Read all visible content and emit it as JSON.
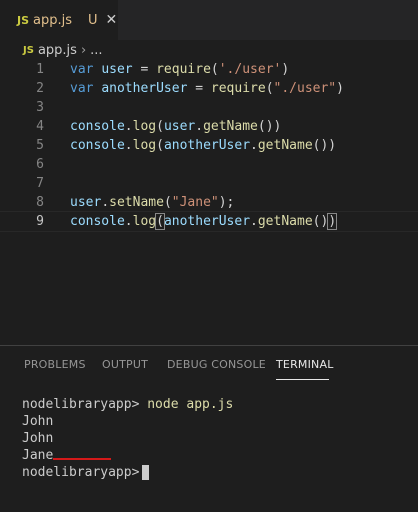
{
  "tab": {
    "icon": "JS",
    "filename": "app.js",
    "status": "U",
    "close": "✕"
  },
  "breadcrumb": {
    "icon": "JS",
    "file": "app.js",
    "separator": "›",
    "more": "..."
  },
  "editor": {
    "lines": [
      {
        "number": "1",
        "text": "var user = require('./user')"
      },
      {
        "number": "2",
        "text": "var anotherUser = require(\"./user\")"
      },
      {
        "number": "3",
        "text": ""
      },
      {
        "number": "4",
        "text": "console.log(user.getName())"
      },
      {
        "number": "5",
        "text": "console.log(anotherUser.getName())"
      },
      {
        "number": "6",
        "text": ""
      },
      {
        "number": "7",
        "text": ""
      },
      {
        "number": "8",
        "text": "user.setName(\"Jane\");"
      },
      {
        "number": "9",
        "text": "console.log(anotherUser.getName())"
      }
    ]
  },
  "panel": {
    "tabs": [
      "PROBLEMS",
      "OUTPUT",
      "DEBUG CONSOLE",
      "TERMINAL"
    ],
    "active_tab": "TERMINAL"
  },
  "terminal": {
    "prompt": "nodelibraryapp>",
    "command": "node app.js",
    "output": [
      "John",
      "John",
      "Jane"
    ],
    "final_prompt": "nodelibraryapp>"
  },
  "colors": {
    "background": "#1e1e1e",
    "keyword": "#569cd6",
    "variable": "#9cdcfe",
    "function": "#dcdcaa",
    "string": "#ce9178",
    "annotation": "#d41919"
  }
}
